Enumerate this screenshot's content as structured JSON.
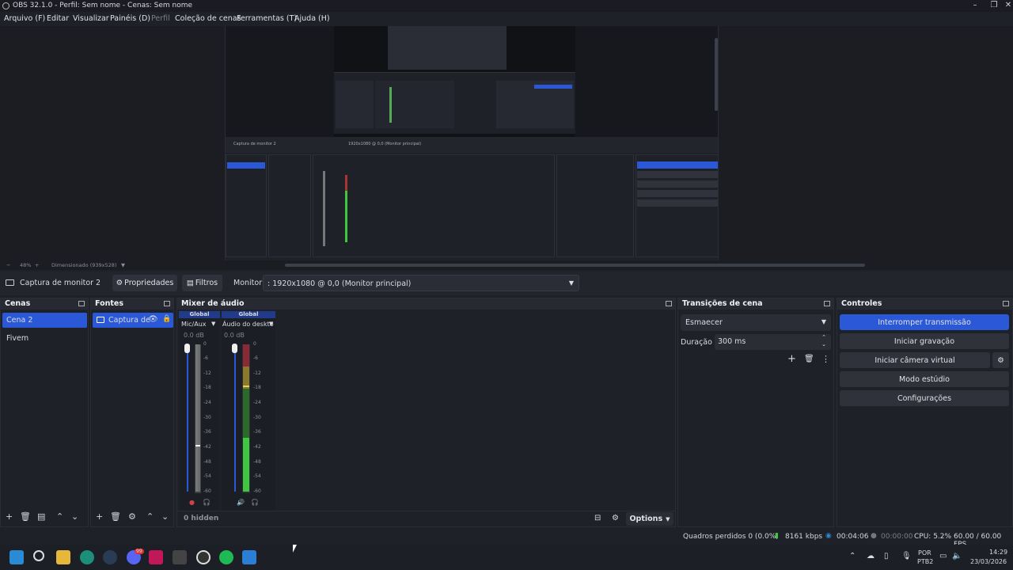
{
  "window": {
    "title": "OBS 32.1.0 - Perfil: Sem nome - Cenas: Sem nome"
  },
  "menu": {
    "items": [
      "Arquivo (F)",
      "Editar",
      "Visualizar",
      "Painéis (D)",
      "Perfil",
      "Coleção de cenas",
      "Ferramentas (T)",
      "Ajuda (H)"
    ]
  },
  "preview": {
    "zoom": "48%",
    "scaling": "Dimensionado (939x528)",
    "nested_source": "Captura de monitor 2",
    "nested_monitor": "1920x1080 @ 0,0 (Monitor principal)",
    "nested_controls": [
      "Interromper transmissão",
      "Iniciar gravação",
      "Iniciar câmera virtual",
      "Modo estúdio",
      "Configurações"
    ]
  },
  "source_bar": {
    "source_name": "Captura de monitor 2",
    "properties_label": "Propriedades",
    "filters_label": "Filtros",
    "monitor_label": "Monitor",
    "monitor_value": ": 1920x1080 @ 0,0 (Monitor principal)"
  },
  "scenes": {
    "title": "Cenas",
    "items": [
      "Cena 2",
      "Fivem"
    ]
  },
  "sources": {
    "title": "Fontes",
    "items": [
      "Captura de"
    ]
  },
  "mixer": {
    "title": "Mixer de áudio",
    "channels": [
      {
        "header": "Global",
        "name": "Mic/Aux",
        "db": "0.0 dB",
        "level": 0.0
      },
      {
        "header": "Global",
        "name": "Áudio do deskto",
        "db": "0.0 dB",
        "level": 0.38
      }
    ],
    "ticks": [
      "0",
      "-6",
      "-12",
      "-18",
      "-24",
      "-30",
      "-36",
      "-42",
      "-48",
      "-54",
      "-60"
    ],
    "hidden_label": "0 hidden",
    "options_label": "Options"
  },
  "transitions": {
    "title": "Transições de cena",
    "selected": "Esmaecer",
    "duration_label": "Duração",
    "duration_value": "300 ms"
  },
  "controls": {
    "title": "Controles",
    "buttons": [
      "Interromper transmissão",
      "Iniciar gravação",
      "Iniciar câmera virtual",
      "Modo estúdio",
      "Configurações"
    ]
  },
  "status": {
    "dropped": "Quadros perdidos 0 (0.0%)",
    "bitrate": "8161 kbps",
    "stream_time": "00:04:06",
    "rec_time": "00:00:00",
    "cpu": "CPU: 5.2%",
    "fps": "60.00 / 60.00 FPS"
  },
  "taskbar": {
    "lang_top": "POR",
    "lang_bottom": "PTB2",
    "time": "14:29",
    "date": "23/03/2026",
    "discord_badge": "99"
  },
  "colors": {
    "accent": "#2b58d6",
    "meter_green": "#3fc83f",
    "meter_yellow": "#c8b43c",
    "meter_red": "#c83c3c"
  }
}
